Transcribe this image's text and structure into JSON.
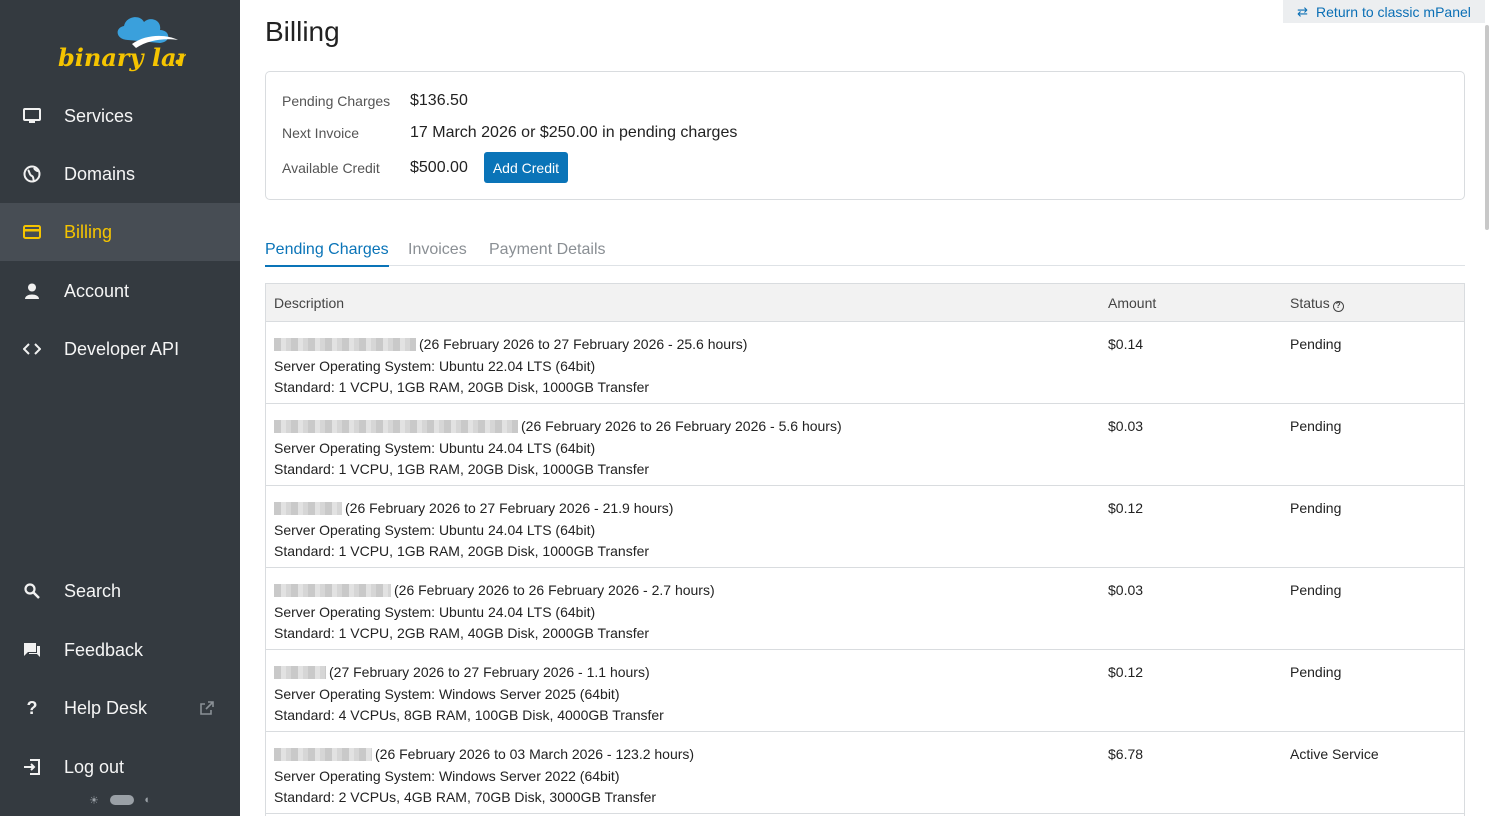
{
  "brand": {
    "name": "binary lane",
    "colors": {
      "sidebar": "#343a40",
      "accent": "#f5c400",
      "primary": "#0a74b8",
      "cloud": "#3aa0dc"
    }
  },
  "nav": {
    "items": [
      {
        "label": "Services",
        "icon": "monitor-icon"
      },
      {
        "label": "Domains",
        "icon": "globe-icon"
      },
      {
        "label": "Billing",
        "icon": "credit-card-icon",
        "active": true
      },
      {
        "label": "Account",
        "icon": "user-icon"
      },
      {
        "label": "Developer API",
        "icon": "code-icon"
      }
    ],
    "bottom": [
      {
        "label": "Search",
        "icon": "search-icon"
      },
      {
        "label": "Feedback",
        "icon": "chat-icon"
      },
      {
        "label": "Help Desk",
        "icon": "question-icon",
        "external": true
      },
      {
        "label": "Log out",
        "icon": "logout-icon"
      }
    ]
  },
  "header": {
    "classic_link": "Return to classic mPanel",
    "title": "Billing"
  },
  "summary": {
    "pending_label": "Pending Charges",
    "pending_value": "$136.50",
    "next_label": "Next Invoice",
    "next_value": "17 March 2026 or $250.00 in pending charges",
    "credit_label": "Available Credit",
    "credit_value": "$500.00",
    "add_credit": "Add Credit"
  },
  "tabs": [
    "Pending Charges",
    "Invoices",
    "Payment Details"
  ],
  "table": {
    "headers": [
      "Description",
      "Amount",
      "Status"
    ],
    "rows": [
      {
        "period": "(26 February 2026 to 27 February 2026 - 25.6 hours)",
        "os": "Server Operating System: Ubuntu 22.04 LTS (64bit)",
        "plan": "Standard: 1 VCPU, 1GB RAM, 20GB Disk, 1000GB Transfer",
        "amount": "$0.14",
        "status": "Pending"
      },
      {
        "period": "(26 February 2026 to 26 February 2026 - 5.6 hours)",
        "os": "Server Operating System: Ubuntu 24.04 LTS (64bit)",
        "plan": "Standard: 1 VCPU, 1GB RAM, 20GB Disk, 1000GB Transfer",
        "amount": "$0.03",
        "status": "Pending"
      },
      {
        "period": "(26 February 2026 to 27 February 2026 - 21.9 hours)",
        "os": "Server Operating System: Ubuntu 24.04 LTS (64bit)",
        "plan": "Standard: 1 VCPU, 1GB RAM, 20GB Disk, 1000GB Transfer",
        "amount": "$0.12",
        "status": "Pending"
      },
      {
        "period": "(26 February 2026 to 26 February 2026 - 2.7 hours)",
        "os": "Server Operating System: Ubuntu 24.04 LTS (64bit)",
        "plan": "Standard: 1 VCPU, 2GB RAM, 40GB Disk, 2000GB Transfer",
        "amount": "$0.03",
        "status": "Pending"
      },
      {
        "period": "(27 February 2026 to 27 February 2026 - 1.1 hours)",
        "os": "Server Operating System: Windows Server 2025 (64bit)",
        "plan": "Standard: 4 VCPUs, 8GB RAM, 100GB Disk, 4000GB Transfer",
        "amount": "$0.12",
        "status": "Pending"
      },
      {
        "period": "(26 February 2026 to 03 March 2026 - 123.2 hours)",
        "os": "Server Operating System: Windows Server 2022 (64bit)",
        "plan": "Standard: 2 VCPUs, 4GB RAM, 70GB Disk, 3000GB Transfer",
        "amount": "$6.78",
        "status": "Active Service"
      }
    ]
  }
}
